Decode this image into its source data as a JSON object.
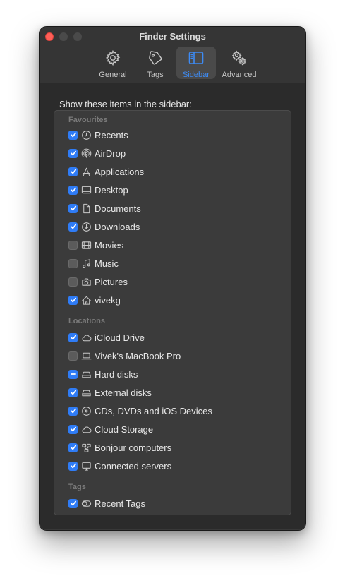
{
  "window": {
    "title": "Finder Settings"
  },
  "toolbar": {
    "tabs": [
      {
        "label": "General",
        "icon": "gear-icon"
      },
      {
        "label": "Tags",
        "icon": "tag-icon"
      },
      {
        "label": "Sidebar",
        "icon": "sidebar-icon",
        "active": true
      },
      {
        "label": "Advanced",
        "icon": "gears-icon"
      }
    ]
  },
  "heading": "Show these items in the sidebar:",
  "sections": {
    "favourites": "Favourites",
    "locations": "Locations",
    "tags": "Tags"
  },
  "items": [
    {
      "label": "Recents",
      "state": "checked",
      "icon": "clock-icon"
    },
    {
      "label": "AirDrop",
      "state": "checked",
      "icon": "airdrop-icon"
    },
    {
      "label": "Applications",
      "state": "checked",
      "icon": "applications-icon"
    },
    {
      "label": "Desktop",
      "state": "checked",
      "icon": "desktop-icon"
    },
    {
      "label": "Documents",
      "state": "checked",
      "icon": "document-icon"
    },
    {
      "label": "Downloads",
      "state": "checked",
      "icon": "download-icon"
    },
    {
      "label": "Movies",
      "state": "unchecked",
      "icon": "film-icon"
    },
    {
      "label": "Music",
      "state": "unchecked",
      "icon": "music-note-icon"
    },
    {
      "label": "Pictures",
      "state": "unchecked",
      "icon": "camera-icon"
    },
    {
      "label": "vivekg",
      "state": "checked",
      "icon": "home-icon"
    },
    {
      "label": "iCloud Drive",
      "state": "checked",
      "icon": "cloud-icon"
    },
    {
      "label": "Vivek's MacBook Pro",
      "state": "unchecked",
      "icon": "laptop-icon"
    },
    {
      "label": "Hard disks",
      "state": "mixed",
      "icon": "disk-icon"
    },
    {
      "label": "External disks",
      "state": "checked",
      "icon": "external-disk-icon"
    },
    {
      "label": "CDs, DVDs and iOS Devices",
      "state": "checked",
      "icon": "optical-disc-icon"
    },
    {
      "label": "Cloud Storage",
      "state": "checked",
      "icon": "cloud-icon"
    },
    {
      "label": "Bonjour computers",
      "state": "checked",
      "icon": "bonjour-icon"
    },
    {
      "label": "Connected servers",
      "state": "checked",
      "icon": "server-icon"
    },
    {
      "label": "Recent Tags",
      "state": "checked",
      "icon": "tag-outline-icon"
    }
  ],
  "colors": {
    "accent": "#2f7cf6",
    "active_tab_text": "#3d8bf5",
    "close_button": "#ff5f57"
  }
}
